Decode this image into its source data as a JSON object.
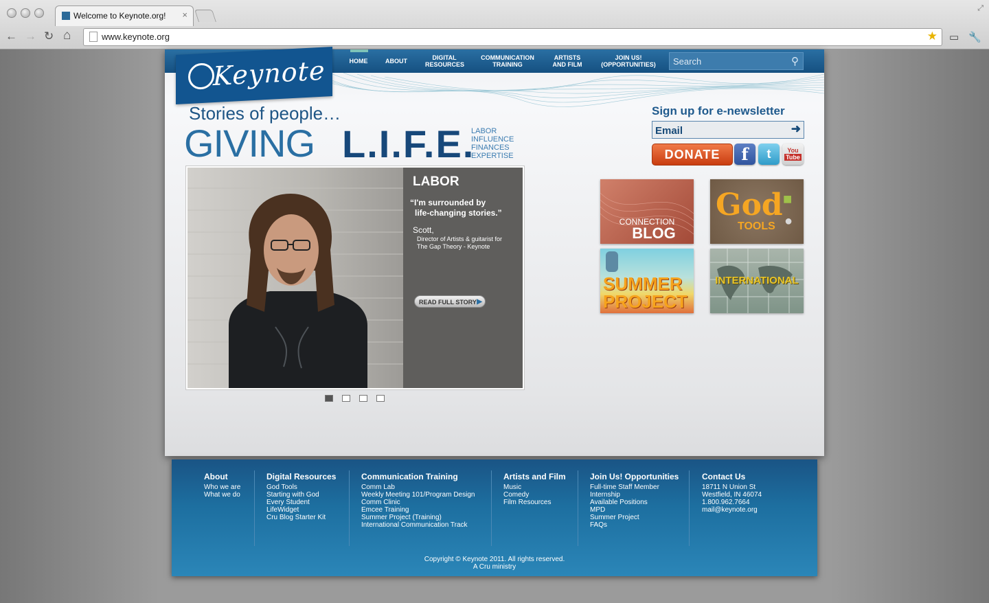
{
  "browser": {
    "tab_title": "Welcome to Keynote.org!",
    "tab_close": "×",
    "url": "www.keynote.org",
    "back": "←",
    "forward": "→",
    "reload": "↻",
    "home": "⌂",
    "star": "★",
    "page_zoom_icon": "▭",
    "wrench_icon": "🔧"
  },
  "site": {
    "logo_text": "Keynote",
    "nav": [
      {
        "label": "HOME",
        "active": true
      },
      {
        "label": "ABOUT"
      },
      {
        "label": "DIGITAL RESOURCES"
      },
      {
        "label": "COMMUNICATION TRAINING"
      },
      {
        "label": "ARTISTS AND FILM"
      },
      {
        "label": "JOIN US! (OPPORTUNITIES)"
      }
    ],
    "search_placeholder": "Search"
  },
  "hero": {
    "tagline": "Stories of people…",
    "giving": "GIVING",
    "life": "L.I.F.E.",
    "life_words": [
      "LABOR",
      "INFLUENCE",
      "FINANCES",
      "EXPERTISE"
    ]
  },
  "slide": {
    "title": "LABOR",
    "quote_line1": "“I'm surrounded by",
    "quote_line2": "life-changing stories.”",
    "name": "Scott,",
    "role_line1": "Director of Artists & guitarist for",
    "role_line2": "The Gap Theory - Keynote",
    "read_more": "READ FULL STORY",
    "dots": [
      true,
      false,
      false,
      false
    ]
  },
  "newsletter": {
    "title": "Sign up for e-newsletter",
    "email_placeholder": "Email",
    "donate": "DONATE"
  },
  "tiles": {
    "blog_small": "CONNECTION",
    "blog_big": "BLOG",
    "god_big": "God",
    "god_small": "TOOLS",
    "summer1": "SUMMER",
    "summer2": "PROJECT",
    "international": "INTERNATIONAL"
  },
  "footer": {
    "columns": [
      {
        "title": "About",
        "links": [
          "Who we are",
          "What we do"
        ]
      },
      {
        "title": "Digital Resources",
        "links": [
          "God Tools",
          "Starting with God",
          "Every Student",
          "LifeWidget",
          "Cru Blog Starter Kit"
        ]
      },
      {
        "title": "Communication Training",
        "links": [
          "Comm Lab",
          "Weekly Meeting 101/Program Design",
          "Comm Clinic",
          "Emcee Training",
          "Summer Project (Training)",
          "International Communication Track"
        ]
      },
      {
        "title": "Artists and Film",
        "links": [
          "Music",
          "Comedy",
          "Film Resources"
        ]
      },
      {
        "title": "Join Us! Opportunities",
        "links": [
          "Full-time Staff Member",
          "Internship",
          "Available Positions",
          "MPD",
          "Summer Project",
          "FAQs"
        ]
      },
      {
        "title": "Contact Us",
        "links": [
          "18711 N Union St",
          "Westfield, IN 46074",
          "1.800.962.7664",
          "mail@keynote.org"
        ]
      }
    ],
    "copyright_line1": "Copyright © Keynote 2011. All rights reserved.",
    "copyright_line2": "A Cru ministry"
  }
}
